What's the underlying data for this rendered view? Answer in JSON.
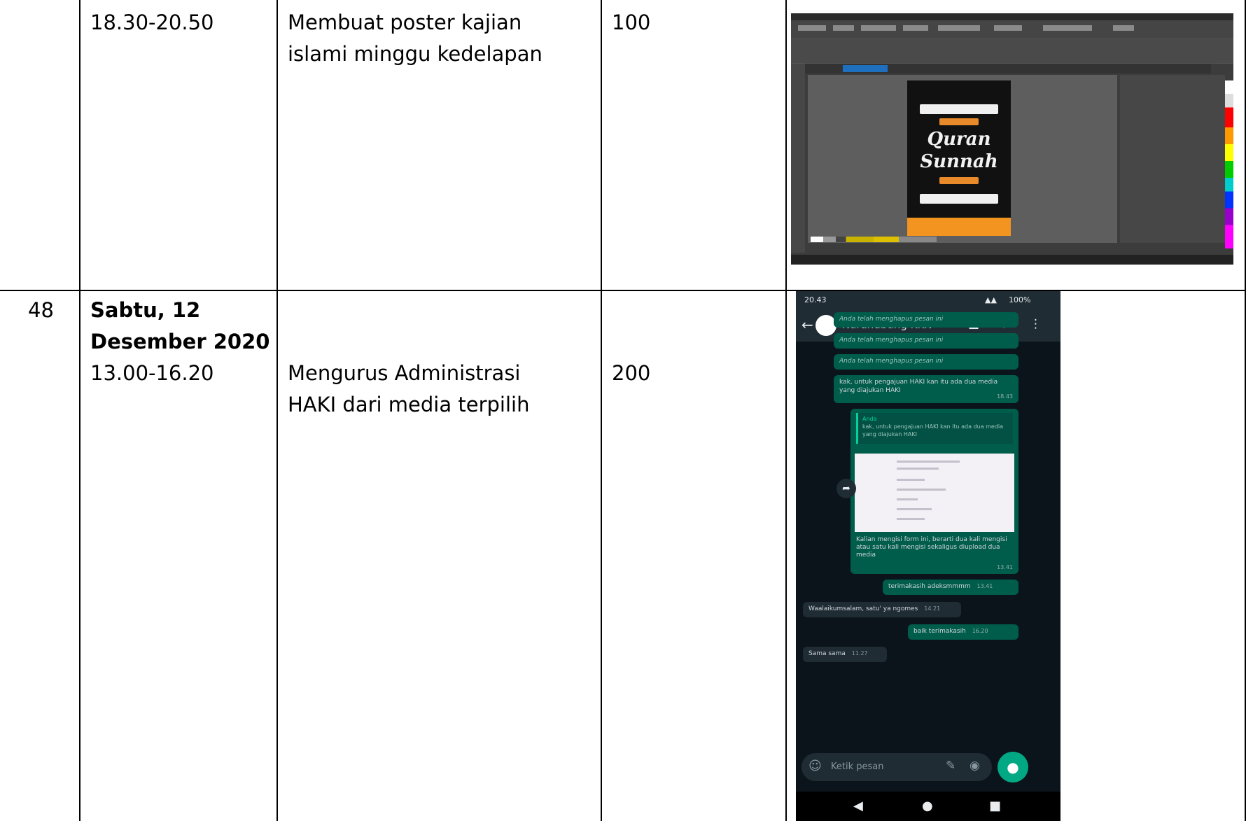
{
  "rows": [
    {
      "no": "",
      "time": "18.30-20.50",
      "activity_line1": "Membuat poster kajian",
      "activity_line2": "islami minggu kedelapan",
      "count": "100",
      "screenshot": {
        "app": "CorelDRAW",
        "poster_title_line1": "Quran",
        "poster_title_line2": "Sunnah"
      }
    },
    {
      "no": "48",
      "date_line1": "Sabtu, 12",
      "date_line2": "Desember 2020",
      "time": "13.00-16.20",
      "activity_line1": "Mengurus Administrasi",
      "activity_line2": "HAKI dari media terpilih",
      "count": "200",
      "screenshot": {
        "app": "WhatsApp",
        "status_time": "20.43",
        "status_battery": "100%",
        "contact_name": "Narahubung KKN",
        "deleted_message": "Anda telah menghapus pesan ini",
        "message_1": "kak, untuk pengajuan HAKI kan itu ada dua media yang diajukan HAKI",
        "message_1_time": "18.43",
        "quote_sender": "Anda",
        "quote_text": "kak, untuk pengajuan HAKI kan itu ada dua media yang diajukan HAKI",
        "message_2": "Kalian mengisi form ini, berarti dua kali mengisi atau satu kali mengisi sekaligus diupload dua media",
        "message_2_time": "13.41",
        "message_3": "terimakasih adeksmmmm",
        "message_3_time": "13.41",
        "message_4": "Waalaikumsalam, satu' ya ngomes",
        "message_4_time": "14.21",
        "message_5": "baik terimakasih",
        "message_5_time": "16.20",
        "message_6": "Sama sama",
        "message_6_time": "11.27",
        "input_placeholder": "Ketik pesan"
      }
    }
  ]
}
